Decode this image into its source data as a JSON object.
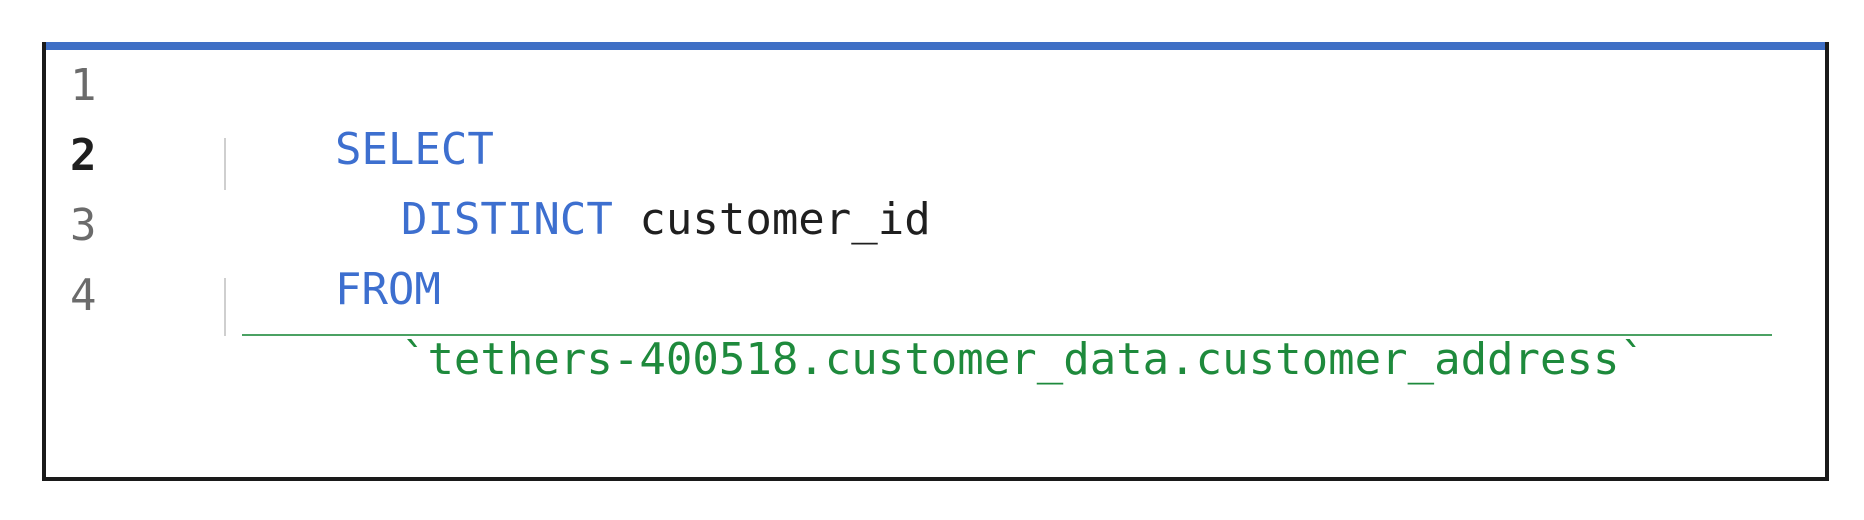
{
  "editor": {
    "lines": [
      {
        "number": "1",
        "keyword": "SELECT",
        "text": ""
      },
      {
        "number": "2",
        "keyword": "DISTINCT",
        "text": " customer_id"
      },
      {
        "number": "3",
        "keyword": "FROM",
        "text": ""
      },
      {
        "number": "4",
        "keyword": "",
        "text": "`tethers-400518.customer_data.customer_address`"
      }
    ]
  },
  "colors": {
    "keyword": "#3d6fcf",
    "identifier": "#1f1f1f",
    "string": "#1e8a3c",
    "line_number": "#6b6b6b",
    "active_line_number": "#1f1f1f",
    "top_bar": "#3f6fc5"
  }
}
